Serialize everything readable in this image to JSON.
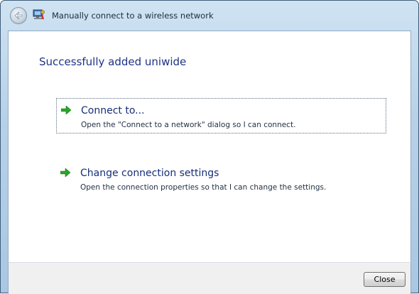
{
  "window": {
    "title": "Manually connect to a wireless network"
  },
  "icons": {
    "back": "back-arrow-icon",
    "network": "wireless-network-icon",
    "option_arrow": "green-arrow-icon"
  },
  "main": {
    "heading": "Successfully added uniwide",
    "options": [
      {
        "title": "Connect to...",
        "description": "Open the \"Connect to a network\" dialog so I can connect."
      },
      {
        "title": "Change connection settings",
        "description": "Open the connection properties so that I can change the settings."
      }
    ]
  },
  "footer": {
    "close_label": "Close"
  },
  "colors": {
    "heading": "#1e3287",
    "arrow": "#2aa52a",
    "frame": "#b7d1e8"
  }
}
